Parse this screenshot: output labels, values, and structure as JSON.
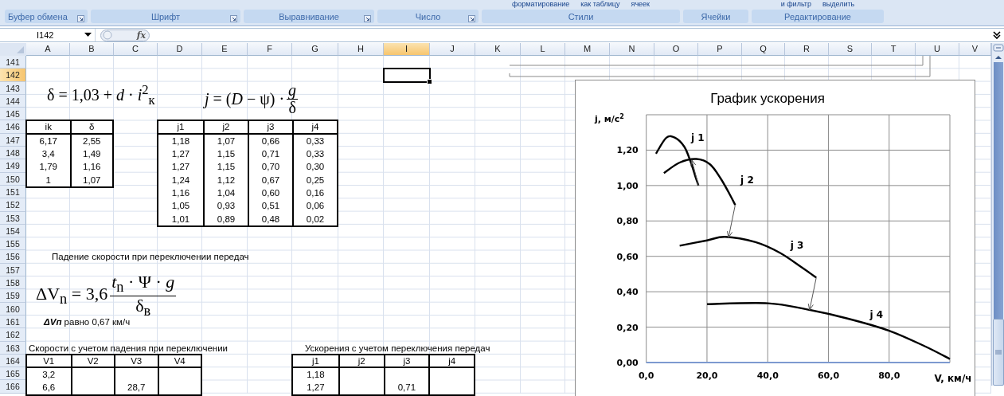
{
  "ribbon": {
    "groups": [
      {
        "label": "Буфер обмена",
        "launcher": true
      },
      {
        "label": "Шрифт",
        "launcher": true
      },
      {
        "label": "Выравнивание",
        "launcher": true
      },
      {
        "label": "Число",
        "launcher": true
      },
      {
        "label": "Стили",
        "launcher": false,
        "fragments": [
          "форматирование",
          "как таблицу",
          "ячеек"
        ]
      },
      {
        "label": "Ячейки",
        "launcher": false
      },
      {
        "label": "Редактирование",
        "launcher": false,
        "fragments": [
          "и фильтр",
          "выделить"
        ]
      }
    ]
  },
  "formula_bar": {
    "name_box": "I142",
    "function_label": "fx"
  },
  "columns": [
    {
      "label": "A",
      "selected": false
    },
    {
      "label": "B",
      "selected": false
    },
    {
      "label": "C",
      "selected": false
    },
    {
      "label": "D",
      "selected": false
    },
    {
      "label": "E",
      "selected": false
    },
    {
      "label": "F",
      "selected": false
    },
    {
      "label": "G",
      "selected": false
    },
    {
      "label": "H",
      "selected": false
    },
    {
      "label": "I",
      "selected": true
    },
    {
      "label": "J",
      "selected": false
    },
    {
      "label": "K",
      "selected": false
    },
    {
      "label": "L",
      "selected": false
    },
    {
      "label": "M",
      "selected": false
    },
    {
      "label": "N",
      "selected": false
    },
    {
      "label": "O",
      "selected": false
    },
    {
      "label": "P",
      "selected": false
    },
    {
      "label": "Q",
      "selected": false
    },
    {
      "label": "R",
      "selected": false
    },
    {
      "label": "S",
      "selected": false
    },
    {
      "label": "T",
      "selected": false
    },
    {
      "label": "U",
      "selected": false
    },
    {
      "label": "V",
      "selected": false
    }
  ],
  "rows": [
    {
      "label": "141",
      "selected": false
    },
    {
      "label": "142",
      "selected": true
    },
    {
      "label": "143",
      "selected": false
    },
    {
      "label": "144",
      "selected": false
    },
    {
      "label": "145",
      "selected": false
    },
    {
      "label": "146",
      "selected": false
    },
    {
      "label": "147",
      "selected": false
    },
    {
      "label": "148",
      "selected": false
    },
    {
      "label": "149",
      "selected": false
    },
    {
      "label": "150",
      "selected": false
    },
    {
      "label": "151",
      "selected": false
    },
    {
      "label": "152",
      "selected": false
    },
    {
      "label": "153",
      "selected": false
    },
    {
      "label": "154",
      "selected": false
    },
    {
      "label": "155",
      "selected": false
    },
    {
      "label": "156",
      "selected": false
    },
    {
      "label": "157",
      "selected": false
    },
    {
      "label": "158",
      "selected": false
    },
    {
      "label": "159",
      "selected": false
    },
    {
      "label": "160",
      "selected": false
    },
    {
      "label": "161",
      "selected": false
    },
    {
      "label": "162",
      "selected": false
    },
    {
      "label": "163",
      "selected": false
    },
    {
      "label": "164",
      "selected": false
    },
    {
      "label": "165",
      "selected": false
    },
    {
      "label": "166",
      "selected": false
    }
  ],
  "delta_formula": "δ = 1,03 + *d* · *i*$^{2}$$_{к}$",
  "acceleration_formula": {
    "lhs": "*j* = (*D* − ψ) ·",
    "numerator": "*g*",
    "denominator": "δ"
  },
  "ik_table": {
    "header": [
      "ik",
      "δ"
    ],
    "rows": [
      [
        "6,17",
        "2,55"
      ],
      [
        "3,4",
        "1,49"
      ],
      [
        "1,79",
        "1,16"
      ],
      [
        "1",
        "1,07"
      ]
    ]
  },
  "j_table": {
    "header": [
      "j1",
      "j2",
      "j3",
      "j4"
    ],
    "rows": [
      [
        "1,18",
        "1,07",
        "0,66",
        "0,33"
      ],
      [
        "1,27",
        "1,15",
        "0,71",
        "0,33"
      ],
      [
        "1,27",
        "1,15",
        "0,70",
        "0,30"
      ],
      [
        "1,24",
        "1,12",
        "0,67",
        "0,25"
      ],
      [
        "1,16",
        "1,04",
        "0,60",
        "0,16"
      ],
      [
        "1,05",
        "0,93",
        "0,51",
        "0,06"
      ],
      [
        "1,01",
        "0,89",
        "0,48",
        "0,02"
      ]
    ]
  },
  "speed_drop_title": "Падение скорости при переключении передач",
  "speed_drop_formula": {
    "lhs": "ΔV$_{n}$ = 3,6",
    "numerator": "*t*$_{n}$ · Ψ · *g*",
    "denominator": "δ$_{в}$"
  },
  "speed_drop_result": "**ΔVп** равно 0,67 км/ч",
  "speeds_title": "Скорости с учетом падения при переключении",
  "speeds_table": {
    "header": [
      "V1",
      "V2",
      "V3",
      "V4"
    ],
    "rows": [
      [
        "3,2",
        null,
        null,
        null
      ],
      [
        "6,6",
        null,
        "28,7",
        null
      ]
    ]
  },
  "accelerations_title": "Ускорения с учетом переключения передач",
  "accelerations_table": {
    "header": [
      "j1",
      "j2",
      "j3",
      "j4"
    ],
    "rows": [
      [
        "1,18",
        null,
        null,
        null
      ],
      [
        "1,27",
        null,
        "0,71",
        null
      ]
    ]
  },
  "chart_data": {
    "type": "line",
    "grid": true,
    "title": "График ускорения",
    "xlabel": "V, км/ч",
    "ylabel": "j, м/с$^{2}$",
    "xlim": [
      0,
      100
    ],
    "ylim": [
      0,
      1.4
    ],
    "xticks": [
      {
        "value": 0,
        "label": "0,0"
      },
      {
        "value": 20,
        "label": "20,0"
      },
      {
        "value": 40,
        "label": "40,0"
      },
      {
        "value": 60,
        "label": "60,0"
      },
      {
        "value": 80,
        "label": "80,0"
      }
    ],
    "yticks": [
      {
        "value": 0,
        "label": "0,00"
      },
      {
        "value": 0.2,
        "label": "0,20"
      },
      {
        "value": 0.4,
        "label": "0,40"
      },
      {
        "value": 0.6,
        "label": "0,60"
      },
      {
        "value": 0.8,
        "label": "0,80"
      },
      {
        "value": 1,
        "label": "1,00"
      },
      {
        "value": 1.2,
        "label": "1,20"
      }
    ],
    "series": [
      {
        "name": "j 1",
        "x": [
          3.2,
          6.6,
          9.5,
          12.5,
          14.5,
          16.2,
          17.2
        ],
        "values": [
          1.18,
          1.27,
          1.27,
          1.22,
          1.14,
          1.05,
          1.0
        ]
      },
      {
        "name": "j 2",
        "x": [
          5.8,
          11,
          16.5,
          21,
          24.5,
          27.5,
          29.3
        ],
        "values": [
          1.07,
          1.13,
          1.15,
          1.12,
          1.04,
          0.95,
          0.89
        ]
      },
      {
        "name": "j 3",
        "x": [
          11,
          20,
          26,
          36,
          44,
          51,
          56
        ],
        "values": [
          0.66,
          0.69,
          0.71,
          0.68,
          0.62,
          0.54,
          0.48
        ]
      },
      {
        "name": "j 4",
        "x": [
          20,
          40,
          53,
          66,
          80,
          92,
          100
        ],
        "values": [
          0.33,
          0.335,
          0.3,
          0.25,
          0.18,
          0.09,
          0.02
        ]
      }
    ]
  }
}
